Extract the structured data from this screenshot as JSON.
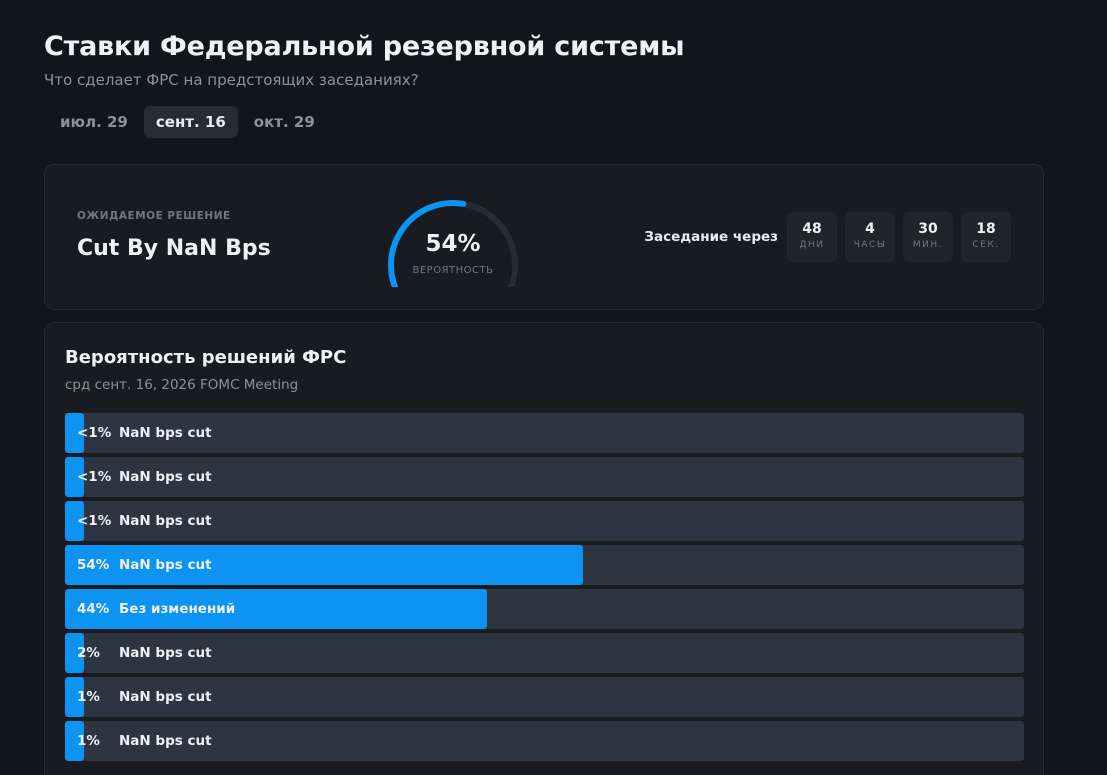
{
  "header": {
    "title": "Ставки Федеральной резервной системы",
    "subtitle": "Что сделает ФРС на предстоящих заседаниях?"
  },
  "tabs": [
    {
      "label": "июл. 29",
      "active": false
    },
    {
      "label": "сент. 16",
      "active": true
    },
    {
      "label": "окт. 29",
      "active": false
    }
  ],
  "summary": {
    "expected_label": "ОЖИДАЕМОЕ РЕШЕНИЕ",
    "expected_value": "Cut By NaN Bps",
    "gauge": {
      "value": 0.54,
      "percent_text": "54%",
      "label": "ВЕРОЯТНОСТЬ"
    },
    "countdown": {
      "label": "Заседание через",
      "units": [
        {
          "value": "48",
          "unit": "ДНИ"
        },
        {
          "value": "4",
          "unit": "ЧАСЫ"
        },
        {
          "value": "30",
          "unit": "МИН."
        },
        {
          "value": "18",
          "unit": "СЕК."
        }
      ]
    }
  },
  "probabilities": {
    "title": "Вероятность решений ФРС",
    "subtitle": "срд сент. 16, 2026 FOMC Meeting",
    "items": [
      {
        "pct_text": "<1%",
        "value": 0.5,
        "label": "NaN bps cut"
      },
      {
        "pct_text": "<1%",
        "value": 0.5,
        "label": "NaN bps cut"
      },
      {
        "pct_text": "<1%",
        "value": 0.5,
        "label": "NaN bps cut"
      },
      {
        "pct_text": "54%",
        "value": 54,
        "label": "NaN bps cut"
      },
      {
        "pct_text": "44%",
        "value": 44,
        "label": "Без изменений"
      },
      {
        "pct_text": "2%",
        "value": 2,
        "label": "NaN bps cut"
      },
      {
        "pct_text": "1%",
        "value": 1,
        "label": "NaN bps cut"
      },
      {
        "pct_text": "1%",
        "value": 1,
        "label": "NaN bps cut"
      }
    ]
  },
  "colors": {
    "accent": "#0d93f2",
    "track": "#2d3540",
    "background": "#12151a",
    "card": "#181b20"
  }
}
